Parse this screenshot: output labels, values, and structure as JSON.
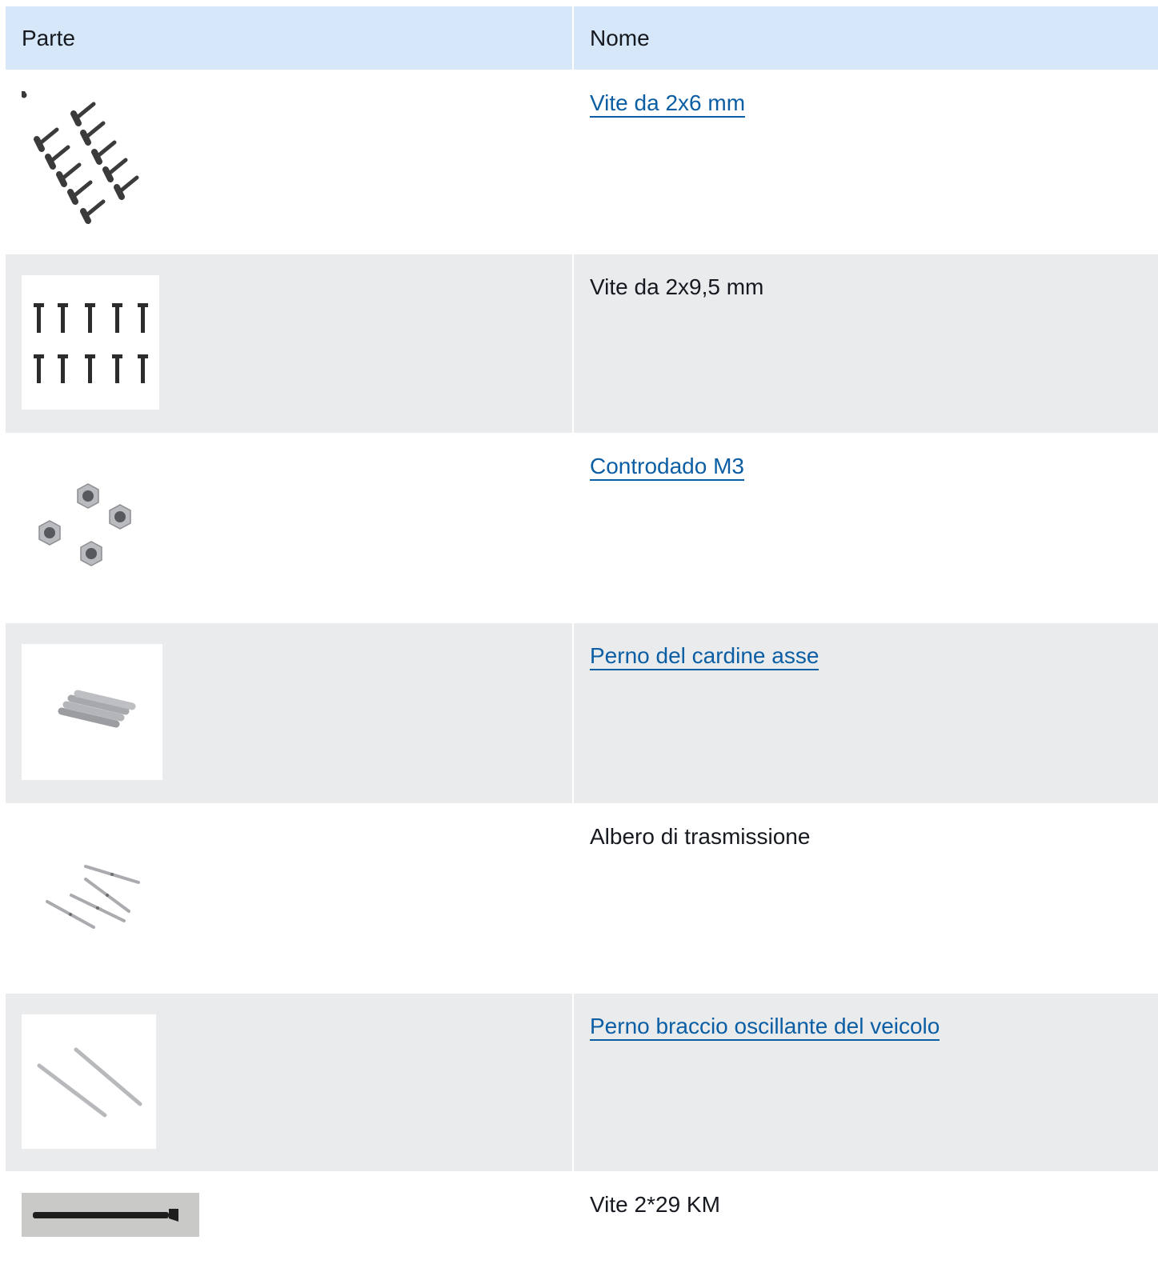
{
  "table": {
    "headers": {
      "part": "Parte",
      "name": "Nome"
    },
    "rows": [
      {
        "name": "Vite da 2x6 mm",
        "link": true,
        "image": "screws-2x6-image"
      },
      {
        "name": "Vite da 2x9,5 mm",
        "link": false,
        "image": "screws-2x9-5-image"
      },
      {
        "name": "Controdado M3",
        "link": true,
        "image": "lock-nuts-m3-image"
      },
      {
        "name": "Perno del cardine asse",
        "link": true,
        "image": "axle-hinge-pins-image"
      },
      {
        "name": "Albero di trasmissione",
        "link": false,
        "image": "drive-shafts-image"
      },
      {
        "name": "Perno braccio oscillante del veicolo",
        "link": true,
        "image": "suspension-arm-pins-image"
      },
      {
        "name": "Vite 2*29 KM",
        "link": false,
        "image": "screw-2x29-image"
      }
    ]
  }
}
